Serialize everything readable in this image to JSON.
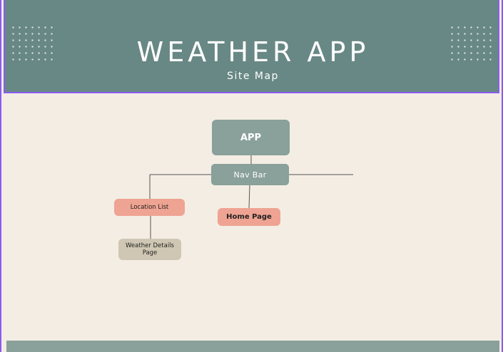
{
  "header": {
    "title": "WEATHER APP",
    "subtitle": "Site Map"
  },
  "sitemap": {
    "root": "APP",
    "nav": "Nav Bar",
    "location_list": "Location List",
    "home_page": "Home Page",
    "weather_details": "Weather Details Page"
  },
  "colors": {
    "header_bg": "#688885",
    "canvas_bg": "#f3ede4",
    "node_primary": "#8aa09a",
    "node_accent": "#efa392",
    "node_secondary": "#cfc7b3",
    "frame_border": "#8a5cf0"
  }
}
